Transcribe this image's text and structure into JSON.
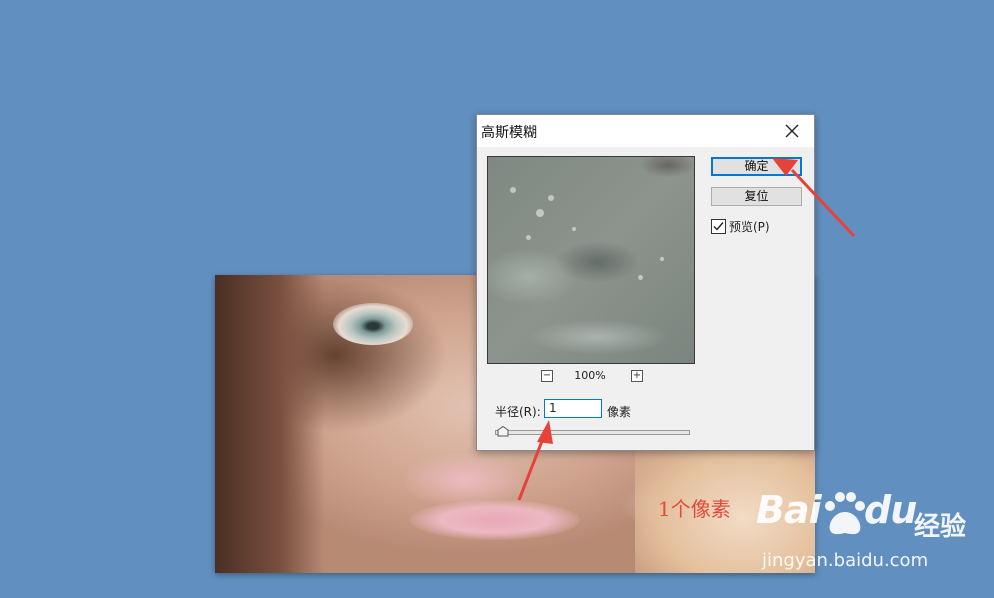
{
  "dialog": {
    "title": "高斯模糊",
    "ok_label": "确定",
    "reset_label": "复位",
    "preview_label": "预览(P)",
    "preview_checked": true,
    "zoom_level": "100%",
    "zoom_out_symbol": "−",
    "zoom_in_symbol": "+",
    "radius_label": "半径(R):",
    "radius_value": "1",
    "radius_unit": "像素"
  },
  "annotation": {
    "text": "1个像素",
    "color": "#e44a3c"
  },
  "watermark": {
    "brand_left": "Bai",
    "brand_right": "du",
    "brand_cn": "经验",
    "url": "jingyan.baidu.com"
  },
  "icons": {
    "close": "close-icon",
    "check": "check-icon",
    "paw": "paw-icon"
  },
  "colors": {
    "background": "#6190c0",
    "focus": "#0078d7",
    "dialog_bg": "#f0f0f0"
  }
}
